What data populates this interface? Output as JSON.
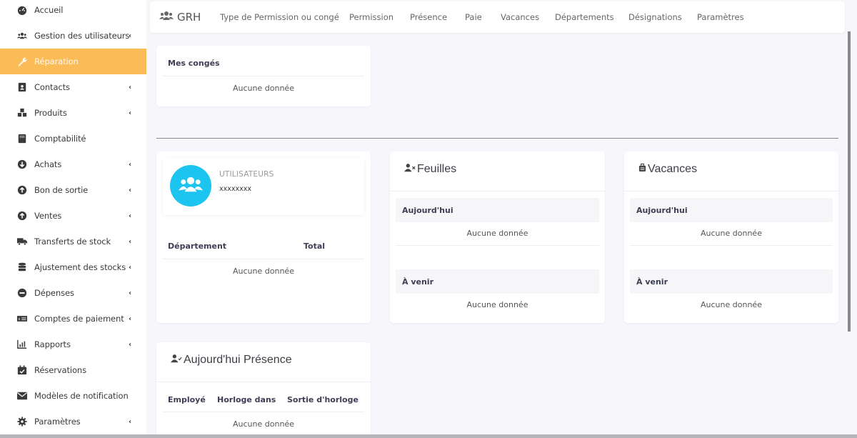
{
  "sidebar": {
    "items": [
      {
        "label": "Accueil",
        "icon": "dashboard-gauge-icon",
        "has_submenu": false,
        "active": false
      },
      {
        "label": "Gestion des utilisateurs",
        "icon": "users-icon",
        "has_submenu": true,
        "active": false
      },
      {
        "label": "Réparation",
        "icon": "wrench-icon",
        "has_submenu": false,
        "active": true
      },
      {
        "label": "Contacts",
        "icon": "address-book-icon",
        "has_submenu": true,
        "active": false
      },
      {
        "label": "Produits",
        "icon": "cubes-icon",
        "has_submenu": true,
        "active": false
      },
      {
        "label": "Comptabilité",
        "icon": "book-icon",
        "has_submenu": false,
        "active": false
      },
      {
        "label": "Achats",
        "icon": "arrow-circle-down-icon",
        "has_submenu": true,
        "active": false
      },
      {
        "label": "Bon de sortie",
        "icon": "arrow-circle-up-icon",
        "has_submenu": true,
        "active": false
      },
      {
        "label": "Ventes",
        "icon": "arrow-circle-up-icon",
        "has_submenu": true,
        "active": false
      },
      {
        "label": "Transferts de stock",
        "icon": "truck-icon",
        "has_submenu": true,
        "active": false
      },
      {
        "label": "Ajustement des stocks",
        "icon": "database-icon",
        "has_submenu": true,
        "active": false
      },
      {
        "label": "Dépenses",
        "icon": "minus-circle-icon",
        "has_submenu": true,
        "active": false
      },
      {
        "label": "Comptes de paiement",
        "icon": "money-check-icon",
        "has_submenu": true,
        "active": false
      },
      {
        "label": "Rapports",
        "icon": "bar-chart-icon",
        "has_submenu": true,
        "active": false
      },
      {
        "label": "Réservations",
        "icon": "calendar-check-icon",
        "has_submenu": false,
        "active": false
      },
      {
        "label": "Modèles de notification",
        "icon": "envelope-icon",
        "has_submenu": false,
        "active": false
      },
      {
        "label": "Paramètres",
        "icon": "gear-icon",
        "has_submenu": true,
        "active": false
      }
    ],
    "chevron": "‹"
  },
  "topnav": {
    "brand": "GRH",
    "brand_icon": "users-icon",
    "links": [
      "Type de Permission ou congé",
      "Permission",
      "Présence",
      "Paie",
      "Vacances",
      "Départements",
      "Désignations",
      "Paramètres"
    ]
  },
  "mes_conges": {
    "title": "Mes congés",
    "empty": "Aucune donnée"
  },
  "users_card": {
    "stat_label": "UTILISATEURS",
    "stat_value": "xxxxxxxx",
    "columns": [
      "Département",
      "Total"
    ],
    "empty": "Aucune donnée"
  },
  "feuilles": {
    "title": "Feuilles",
    "icon": "user-times-icon",
    "today_label": "Aujourd'hui",
    "today_empty": "Aucune donnée",
    "upcoming_label": "À venir",
    "upcoming_empty": "Aucune donnée"
  },
  "vacances": {
    "title": "Vacances",
    "icon": "suitcase-icon",
    "today_label": "Aujourd'hui",
    "today_empty": "Aucune donnée",
    "upcoming_label": "À venir",
    "upcoming_empty": "Aucune donnée"
  },
  "presence": {
    "title": "Aujourd'hui Présence",
    "icon": "user-check-icon",
    "columns": [
      "Employé",
      "Horloge dans",
      "Sortie d'horloge"
    ],
    "empty": "Aucune donnée"
  },
  "colors": {
    "active_item": "#fbbc58",
    "stat_circle": "#1bc5ef",
    "background": "#f6f6fb"
  }
}
